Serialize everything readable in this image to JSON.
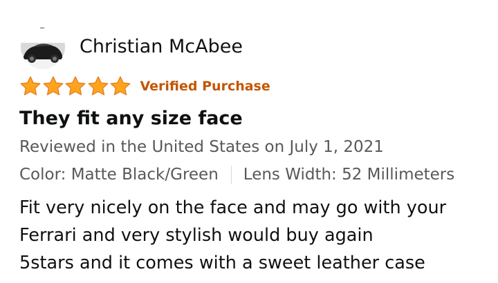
{
  "reviewer": {
    "name": "Christian McAbee",
    "avatar_icon": "car-photo-avatar"
  },
  "rating": {
    "stars": 5,
    "max_stars": 5,
    "star_color": "#ffa41c",
    "verified_label": "Verified Purchase",
    "verified_color": "#c45500"
  },
  "review": {
    "title": "They fit any size face",
    "date_line": "Reviewed in the United States on July 1, 2021",
    "color_variant": "Color: Matte Black/Green",
    "lens_width": "Lens Width: 52 Millimeters",
    "body_lines": [
      "Fit very nicely on the face and may go with your",
      "Ferrari and very stylish would buy again",
      "5stars and it comes with a sweet leather case"
    ]
  }
}
